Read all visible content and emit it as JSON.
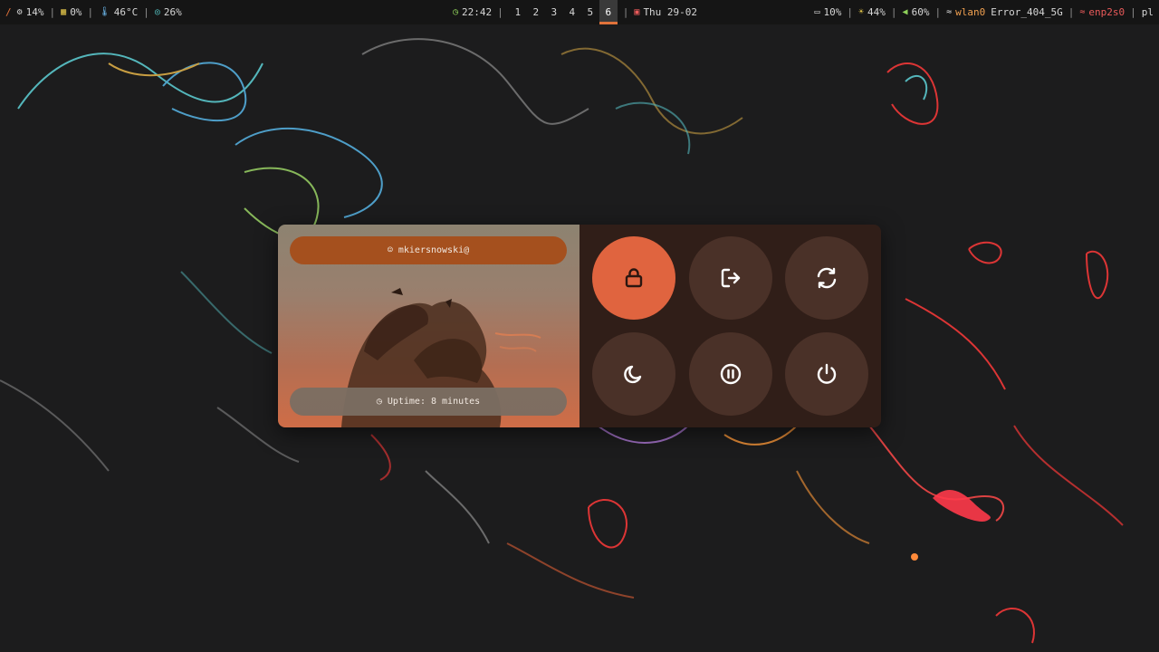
{
  "bar": {
    "left": [
      {
        "icon": "cpu-icon",
        "value": "14%"
      },
      {
        "icon": "memory-icon",
        "value": "0%"
      },
      {
        "icon": "thermometer-icon",
        "value": "46°C"
      },
      {
        "icon": "disk-icon",
        "value": "26%"
      }
    ],
    "left_marker": "/",
    "clock": "22:42",
    "workspaces": [
      "1",
      "2",
      "3",
      "4",
      "5",
      "6"
    ],
    "active_workspace": "6",
    "date": "Thu 29-02",
    "battery": "10%",
    "brightness": "44%",
    "volume": "60%",
    "wlan_iface": "wlan0",
    "wlan_ssid": "Error_404_5G",
    "eth_iface": "enp2s0",
    "keyboard": "pl"
  },
  "menu": {
    "user": "mkiersnowski@",
    "uptime": "Uptime: 8 minutes",
    "buttons": [
      {
        "name": "lock",
        "icon": "lock-icon"
      },
      {
        "name": "logout",
        "icon": "logout-icon"
      },
      {
        "name": "reboot",
        "icon": "reboot-icon"
      },
      {
        "name": "sleep",
        "icon": "moon-icon"
      },
      {
        "name": "suspend",
        "icon": "pause-icon"
      },
      {
        "name": "shutdown",
        "icon": "power-icon"
      }
    ]
  },
  "colors": {
    "accent": "#e0643f",
    "user_pill": "#a5501e",
    "button_bg": "#4a3128",
    "panel_bg": "#301e18",
    "bar_bg": "#151515"
  }
}
